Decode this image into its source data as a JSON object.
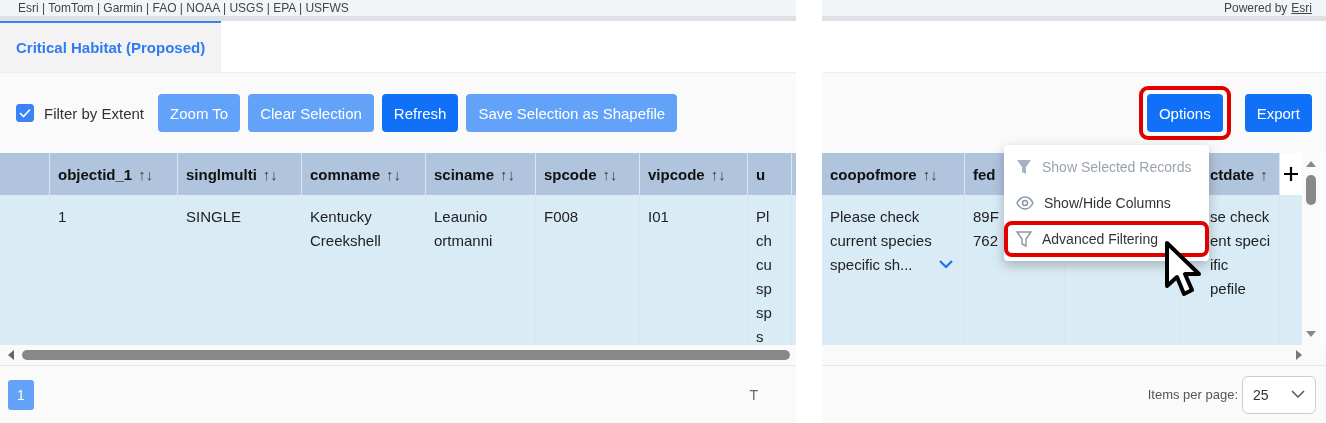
{
  "map_attribution": {
    "sources": "Esri | TomTom | Garmin | FAO | NOAA | USGS | EPA | USFWS",
    "powered_by": "Powered by",
    "link": "Esri"
  },
  "tabs": [
    {
      "label": "Critical Habitat (Proposed)",
      "selected": true
    }
  ],
  "filter_by_extent": {
    "label": "Filter by Extent",
    "checked": true
  },
  "toolbar_buttons": [
    {
      "label": "Zoom To",
      "kind": "light"
    },
    {
      "label": "Clear Selection",
      "kind": "light"
    },
    {
      "label": "Refresh",
      "kind": "primary"
    },
    {
      "label": "Save Selection as Shapefile",
      "kind": "light"
    }
  ],
  "right_buttons": [
    {
      "label": "Options",
      "highlighted": true
    },
    {
      "label": "Export",
      "highlighted": false
    }
  ],
  "left_table": {
    "columns": [
      {},
      {
        "label": "objectid_1",
        "sort": "↑↓"
      },
      {
        "label": "singlmulti",
        "sort": "↑↓"
      },
      {
        "label": "comname",
        "sort": "↑↓"
      },
      {
        "label": "sciname",
        "sort": "↑↓"
      },
      {
        "label": "spcode",
        "sort": "↑↓"
      },
      {
        "label": "vipcode",
        "sort": "↑↓"
      },
      {
        "label": "u"
      }
    ],
    "rows": [
      {
        "selected": true,
        "cells": [
          {},
          {
            "text": "1"
          },
          {
            "text": "SINGLE"
          },
          {
            "text": "Kentucky\nCreekshell"
          },
          {
            "text": "Leaunio\nortmanni"
          },
          {
            "text": "F008"
          },
          {
            "text": "I01"
          },
          {
            "text": "Pl\nch\ncu\nsp\nsp\ns"
          }
        ]
      }
    ]
  },
  "right_table": {
    "columns": [
      {
        "label": "coopofmore",
        "sort": "↑↓"
      },
      {
        "label": "fed"
      },
      {},
      {
        "label": "ctdate",
        "sort": "↑"
      }
    ],
    "rows": [
      {
        "selected": true,
        "cells": [
          {
            "text": "Please check\ncurrent species\nspecific sh...",
            "expandable": true
          },
          {
            "text": "89F\n762"
          },
          {},
          {
            "text": "se check\nent speci\nific\npefile"
          }
        ]
      }
    ]
  },
  "options_menu": [
    {
      "label": "Show Selected Records",
      "kind": "filter-solid",
      "disabled": true,
      "highlighted": false
    },
    {
      "label": "Show/Hide Columns",
      "kind": "eye",
      "disabled": false,
      "highlighted": false
    },
    {
      "label": "Advanced Filtering",
      "kind": "filter-outline",
      "disabled": false,
      "highlighted": true
    }
  ],
  "pagination": {
    "pages": [
      {
        "label": "1",
        "selected": true
      }
    ],
    "info": "T"
  },
  "items_per_page": {
    "label": "Items per page:",
    "value": "25"
  }
}
